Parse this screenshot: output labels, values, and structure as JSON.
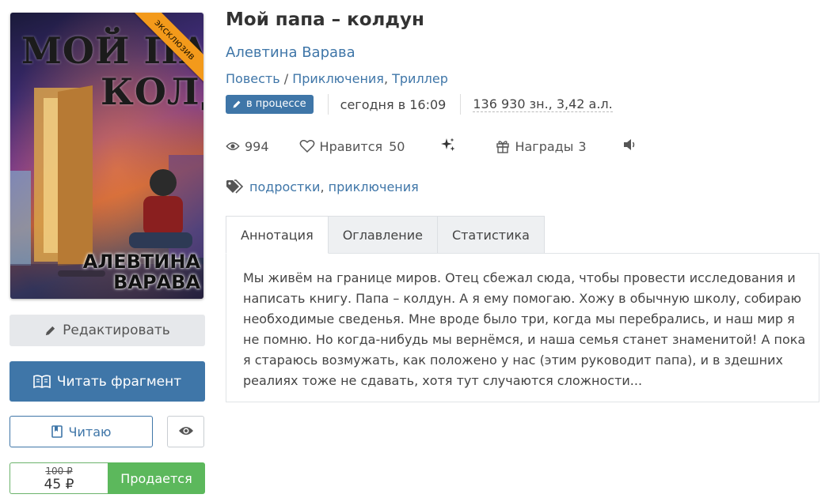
{
  "cover": {
    "title_line1": "МОЙ ПАПА",
    "title_line2": "КОЛДУН",
    "author_line1": "АЛЕВТИНА",
    "author_line2": "ВАРАВА",
    "ribbon": "эксклюзив",
    "ribbon_color": "#f39a1b"
  },
  "actions": {
    "edit_label": "Редактировать",
    "read_fragment_label": "Читать фрагмент",
    "reading_label": "Читаю",
    "old_price": "100 ₽",
    "new_price": "45 ₽",
    "sale_label": "Продается"
  },
  "book": {
    "title": "Мой папа – колдун",
    "author": "Алевтина Варава",
    "genres": [
      "Повесть",
      "Приключения",
      "Триллер"
    ],
    "status": "в процессе",
    "updated": "сегодня в 16:09",
    "size": "136 930 зн., 3,42 а.л."
  },
  "stats": {
    "views": "994",
    "likes_label": "Нравится",
    "likes": "50",
    "awards_label": "Награды",
    "awards": "3"
  },
  "tags": [
    "подростки",
    "приключения"
  ],
  "tabs": [
    "Аннотация",
    "Оглавление",
    "Статистика"
  ],
  "annotation": "Мы живём на границе миров. Отец сбежал сюда, чтобы провести исследования и написать книгу. Папа – колдун. А я ему помогаю. Хожу в обычную школу, собираю необходимые сведенья. Мне вроде было три, когда мы перебрались, и наш мир я не помню. Но когда-нибудь мы вернёмся, и наша семья станет знаменитой! А пока я стараюсь возмужать, как положено у нас (этим руководит папа), и в здешних реалиях тоже не сдавать, хотя тут случаются сложности...",
  "colors": {
    "primary": "#3f76a8",
    "success": "#5cb85c",
    "tab_bg": "#eef0f2"
  }
}
